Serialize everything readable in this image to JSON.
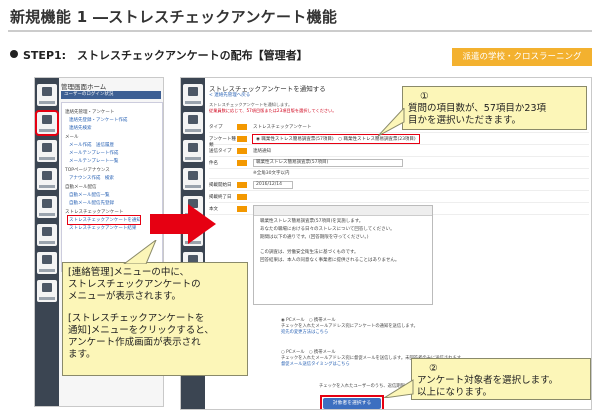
{
  "slide": {
    "title": "新規機能 1 ―ストレスチェックアンケート機能",
    "step": "STEP1:　ストレスチェックアンケートの配布【管理者】",
    "badge": "派遣の学校・クロスラーニング"
  },
  "left_screen": {
    "header": "管理画面ホーム",
    "user_bar": "ユーザーのログイン状況",
    "menu": [
      {
        "type": "section",
        "text": "連絡先管理・アンケート"
      },
      {
        "type": "item",
        "text": "連絡先登録・アンケート作成"
      },
      {
        "type": "item",
        "text": "連絡先検索"
      },
      {
        "type": "section",
        "text": "メール"
      },
      {
        "type": "item",
        "text": "メール作成　送信履歴"
      },
      {
        "type": "item",
        "text": "メールテンプレート作成"
      },
      {
        "type": "item",
        "text": "メールテンプレート一覧"
      },
      {
        "type": "section",
        "text": "TOPページアナウンス"
      },
      {
        "type": "item",
        "text": "アナウンス作成　検索"
      },
      {
        "type": "section",
        "text": "自動メール配信"
      },
      {
        "type": "item",
        "text": "自動メール配信一覧"
      },
      {
        "type": "item",
        "text": "自動メール配信先登録"
      },
      {
        "type": "section",
        "text": "ストレスチェックアンケート"
      },
      {
        "type": "item",
        "text": "ストレスチェックアンケートを通知",
        "highlight": true
      },
      {
        "type": "item",
        "text": "ストレスチェックアンケート結果"
      }
    ]
  },
  "right_screen": {
    "title": "ストレスチェックアンケートを通知する",
    "breadcrumb": "< 連絡先管理へ戻る",
    "description": "ストレスチェックアンケートを通知します。",
    "description_red": "従業員数に応じて、57項目版または23項目版を選択してください。",
    "fields": [
      {
        "label": "タイプ",
        "value": "ストレスチェックアンケート"
      },
      {
        "label": "アンケート種類",
        "value": "◉ 職業性ストレス簡易調査票(57項目)　○ 職業性ストレス簡易調査票(23項目)",
        "highlight": true
      },
      {
        "label": "送信タイプ",
        "value": "連絡通知"
      },
      {
        "label": "件名",
        "value": "職業性ストレス簡易調査票(57項目)"
      },
      {
        "label": "",
        "value": "※全角30文字以内"
      },
      {
        "label": "掲載開始日",
        "value": "2016/12/14"
      },
      {
        "label": "掲載終了日",
        "value": ""
      },
      {
        "label": "本文",
        "value": ""
      }
    ],
    "editor_lines": [
      "職業性ストレス簡易調査票(57項目)を実施します。",
      "あなたの職場における日々のストレスについて回答してください。",
      "期間は以下の通りです。(回答期限を守ってください。)",
      "",
      "この調査は、労働安全衛生法に基づくものです。",
      "回答結果は、本人の同意なく事業者に提供されることはありません。"
    ],
    "options": [
      {
        "label": "メール送信先",
        "choice": "◉ PCメール　○ 携帯メール",
        "note": "チェックを入れたメールアドレス宛にアンケートの通知を送信します。",
        "link": "宛先の変更方法はこちら"
      },
      {
        "label": "メール送信先",
        "choice": "○ PCメール　○ 携帯メール",
        "note": "チェックを入れたメールアドレス宛に督促メールを送信します。未回答者のみに送信されます。",
        "link": "督促メール送信タイミングはこちら"
      }
    ],
    "target_line": "チェックを入れたユーザーのうち、返信期限までに　○　日前　○　日前",
    "submit": "対象者を選択する"
  },
  "callouts": {
    "a": {
      "line1": "[連絡管理]メニューの中に、",
      "line2": "ストレスチェックアンケートの",
      "line3": "メニューが表示されます。",
      "line4": "[ストレスチェックアンケートを",
      "line5": "通知]メニューをクリックすると、",
      "line6": "アンケート作成画面が表示され",
      "line7": "ます。"
    },
    "b": {
      "num": "①",
      "line1": "質問の項目数が、57項目か23項",
      "line2": "目かを選択いただきます。"
    },
    "c": {
      "num": "②",
      "line1": "アンケート対象者を選択します。",
      "line2": "以上になります。"
    }
  },
  "colors": {
    "badge": "#f3b12f",
    "highlight": "#e60012",
    "arrow": "#e60012",
    "callout_bg": "#fcf6b8",
    "nav": "#3b4552",
    "submit": "#3d6fc0"
  }
}
